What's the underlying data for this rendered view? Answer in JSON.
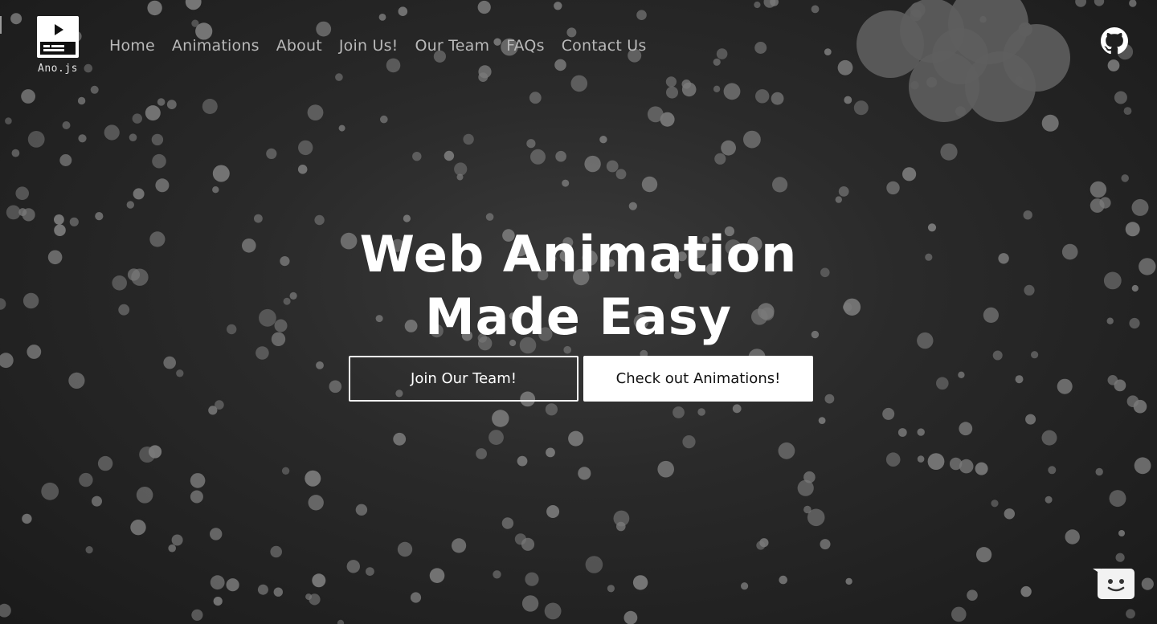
{
  "brand": {
    "name": "Ano.js",
    "logo_icon": "play-video-icon"
  },
  "nav": {
    "items": [
      {
        "label": "Home"
      },
      {
        "label": "Animations"
      },
      {
        "label": "About"
      },
      {
        "label": "Join Us!"
      },
      {
        "label": "Our Team"
      },
      {
        "label": "FAQs"
      },
      {
        "label": "Contact Us"
      }
    ]
  },
  "header": {
    "github_icon": "github-icon"
  },
  "hero": {
    "title_line1": "Web Animation",
    "title_line2": "Made Easy",
    "primary_button": "Join Our Team!",
    "secondary_button": "Check out Animations!"
  },
  "chat": {
    "icon": "chat-smiley-icon"
  },
  "colors": {
    "background": "#222222",
    "particle": "#7a7a7a",
    "text": "#ffffff",
    "nav_text": "#b9b9b9"
  }
}
